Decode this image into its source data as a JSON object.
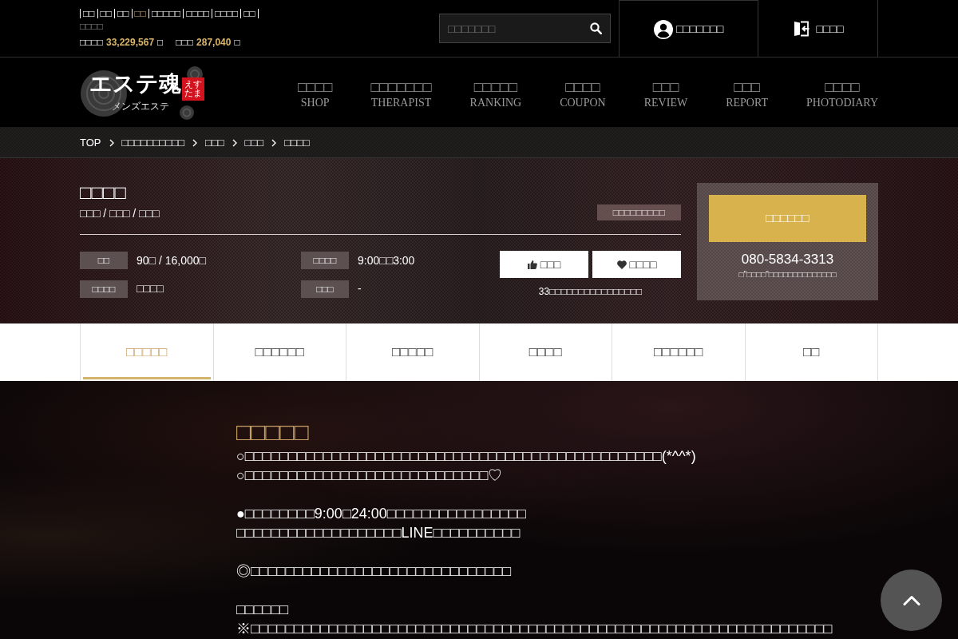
{
  "top_bar": {
    "links": [
      {
        "label": "□□",
        "selected": false
      },
      {
        "label": "□□",
        "selected": false
      },
      {
        "label": "□□",
        "selected": false
      },
      {
        "label": "□□",
        "selected": true
      },
      {
        "label": "□□□□□",
        "selected": false
      },
      {
        "label": "□□□□",
        "selected": false
      },
      {
        "label": "□□□□",
        "selected": false
      },
      {
        "label": "□□",
        "selected": false
      }
    ],
    "note": "□□□□",
    "stats": [
      {
        "label": "□□□□",
        "value": "33,229,567",
        "unit": "□"
      },
      {
        "label": "□□□",
        "value": "287,040",
        "unit": "□"
      }
    ]
  },
  "search": {
    "placeholder": "□□□□□□□"
  },
  "account": {
    "login": "□□□□□□□",
    "logout": "□□□□"
  },
  "logo": {
    "title": "エステ魂",
    "stamp": "えすたま",
    "tagline": "メンズエステ"
  },
  "nav": [
    {
      "label": "□□□□",
      "english": "SHOP"
    },
    {
      "label": "□□□□□□□",
      "english": "THERAPIST"
    },
    {
      "label": "□□□□□",
      "english": "RANKING"
    },
    {
      "label": "□□□□",
      "english": "COUPON"
    },
    {
      "label": "□□□",
      "english": "REVIEW"
    },
    {
      "label": "□□□",
      "english": "REPORT"
    },
    {
      "label": "□□□□",
      "english": "PHOTODIARY"
    }
  ],
  "breadcrumb": [
    "TOP",
    "□□□□□□□□□□",
    "□□□",
    "□□□",
    "□□□□"
  ],
  "shop": {
    "name": "□□□□",
    "areas": "□□□ / □□□ / □□□",
    "tag": "□□□□□□□□□",
    "info": [
      {
        "label": "□□",
        "value": "90□ / 16,000□"
      },
      {
        "label": "□□□□",
        "value": "9:00□□3:00"
      },
      {
        "label": "□□□□",
        "value": "□□□□"
      },
      {
        "label": "□□□",
        "value": "-"
      }
    ],
    "actions": [
      {
        "kind": "like",
        "label": "□□□"
      },
      {
        "kind": "favorite",
        "label": "□□□□"
      }
    ],
    "action_note": "33□□□□□□□□□□□□□□□□",
    "reserve": {
      "button": "□□□□□□",
      "phone": "080-5834-3313",
      "note": "□\"□□□□\"□□□□□□□□□□□□□□"
    }
  },
  "tabs": [
    {
      "label": "□□□□□",
      "selected": true
    },
    {
      "label": "□□□□□□",
      "selected": false
    },
    {
      "label": "□□□□□",
      "selected": false
    },
    {
      "label": "□□□□",
      "selected": false
    },
    {
      "label": "□□□□□□",
      "selected": false
    },
    {
      "label": "□□",
      "selected": false
    }
  ],
  "content": {
    "heading": "□□□□□",
    "blocks": [
      {
        "kind": "text",
        "lines": [
          "○□□□□□□□□□□□□□□□□□□□□□□□□□□□□□□□□□□□□□□□□□□□□□□□□(*^^*)",
          "○□□□□□□□□□□□□□□□□□□□□□□□□□□□□♡"
        ]
      },
      {
        "kind": "text",
        "lines": [
          "●□□□□□□□□9:00□24:00□□□□□□□□□□□□□□□□",
          "□□□□□□□□□□□□□□□□□□□LINE□□□□□□□□□□"
        ]
      },
      {
        "kind": "text",
        "lines": [
          "◎□□□□□□□□□□□□□□□□□□□□□□□□□□□□□□"
        ]
      },
      {
        "kind": "subheading",
        "text": "□□□□□□"
      },
      {
        "kind": "text",
        "lines": [
          "※□□□□□□□□□□□□□□□□□□□□□□□□□□□□□□□□□□□□□□□□□□□□□□□□□□□□□□□□□□□□□□□□□□□"
        ]
      }
    ]
  }
}
